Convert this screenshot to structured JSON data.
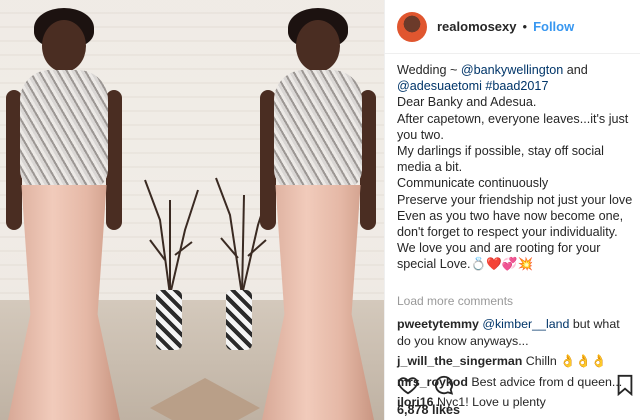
{
  "post": {
    "username": "realomosexy",
    "dot": "•",
    "follow_label": "Follow",
    "caption_lines": [
      [
        "Wedding ~ ",
        "@bankywellington",
        " and"
      ],
      [
        "@adesuaetomi",
        " ",
        "#baad2017"
      ],
      [
        "Dear Banky and Adesua.",
        "",
        ""
      ],
      [
        "After capetown, everyone leaves...it's just",
        "",
        ""
      ],
      [
        "you two.",
        "",
        ""
      ],
      [
        "My darlings if possible, stay off social",
        "",
        ""
      ],
      [
        "media a bit.",
        "",
        ""
      ],
      [
        "Communicate continuously",
        "",
        ""
      ],
      [
        "Preserve your friendship not just your love",
        "",
        ""
      ],
      [
        "Even as you two have now become one,",
        "",
        ""
      ],
      [
        "don't forget to respect your individuality.",
        "",
        ""
      ],
      [
        "We love you and are rooting for your",
        "",
        ""
      ],
      [
        "special Love.💍❤️💞💥",
        "",
        ""
      ]
    ],
    "load_more": "Load more comments",
    "comments": [
      {
        "user": "pweetytemmy",
        "text": " @kimber__land but what do you know anyways..."
      },
      {
        "user": "j_will_the_singerman",
        "text": " Chilln 👌👌👌"
      },
      {
        "user": "mrs_roykod",
        "text": " Best advice from d queen..."
      },
      {
        "user": "ilori16",
        "text": " Nyc1! Love u plenty"
      }
    ],
    "likes": "6,878 likes"
  },
  "icons": {
    "like": "heart-outline-icon",
    "comment": "comment-bubble-icon",
    "save": "bookmark-icon"
  },
  "colors": {
    "follow": "#3897f0",
    "text": "#262626",
    "muted": "#999999"
  }
}
